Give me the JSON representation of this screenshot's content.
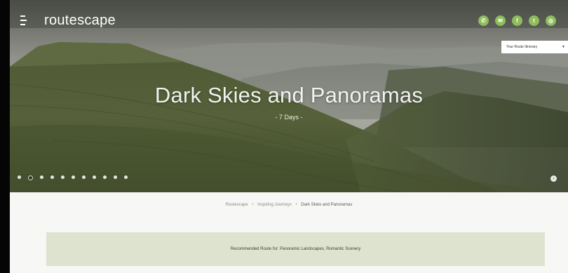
{
  "header": {
    "logo": "routescape",
    "social": [
      {
        "icon": "phone-icon",
        "glyph": "✆"
      },
      {
        "icon": "email-icon",
        "glyph": "✉"
      },
      {
        "icon": "facebook-icon",
        "glyph": "f"
      },
      {
        "icon": "twitter-icon",
        "glyph": "t"
      },
      {
        "icon": "instagram-icon",
        "glyph": "◎"
      }
    ],
    "route_select": {
      "value": "Your Route Itinerary"
    }
  },
  "hero": {
    "title": "Dark Skies and Panoramas",
    "subtitle": "- 7 Days -",
    "slide_count": 11,
    "active_slide": 2
  },
  "breadcrumb": {
    "items": [
      "Routescape",
      "Inspiring Journeys",
      "Dark Skies and Panoramas"
    ],
    "separator": "•"
  },
  "recommend": {
    "text": "Recommended Route for: Panoramic Landscapes, Romantic Scenery"
  },
  "colors": {
    "accent": "#8ebd5c",
    "recommend_bg": "#dde3cf",
    "page_bg": "#f7f7f5"
  }
}
